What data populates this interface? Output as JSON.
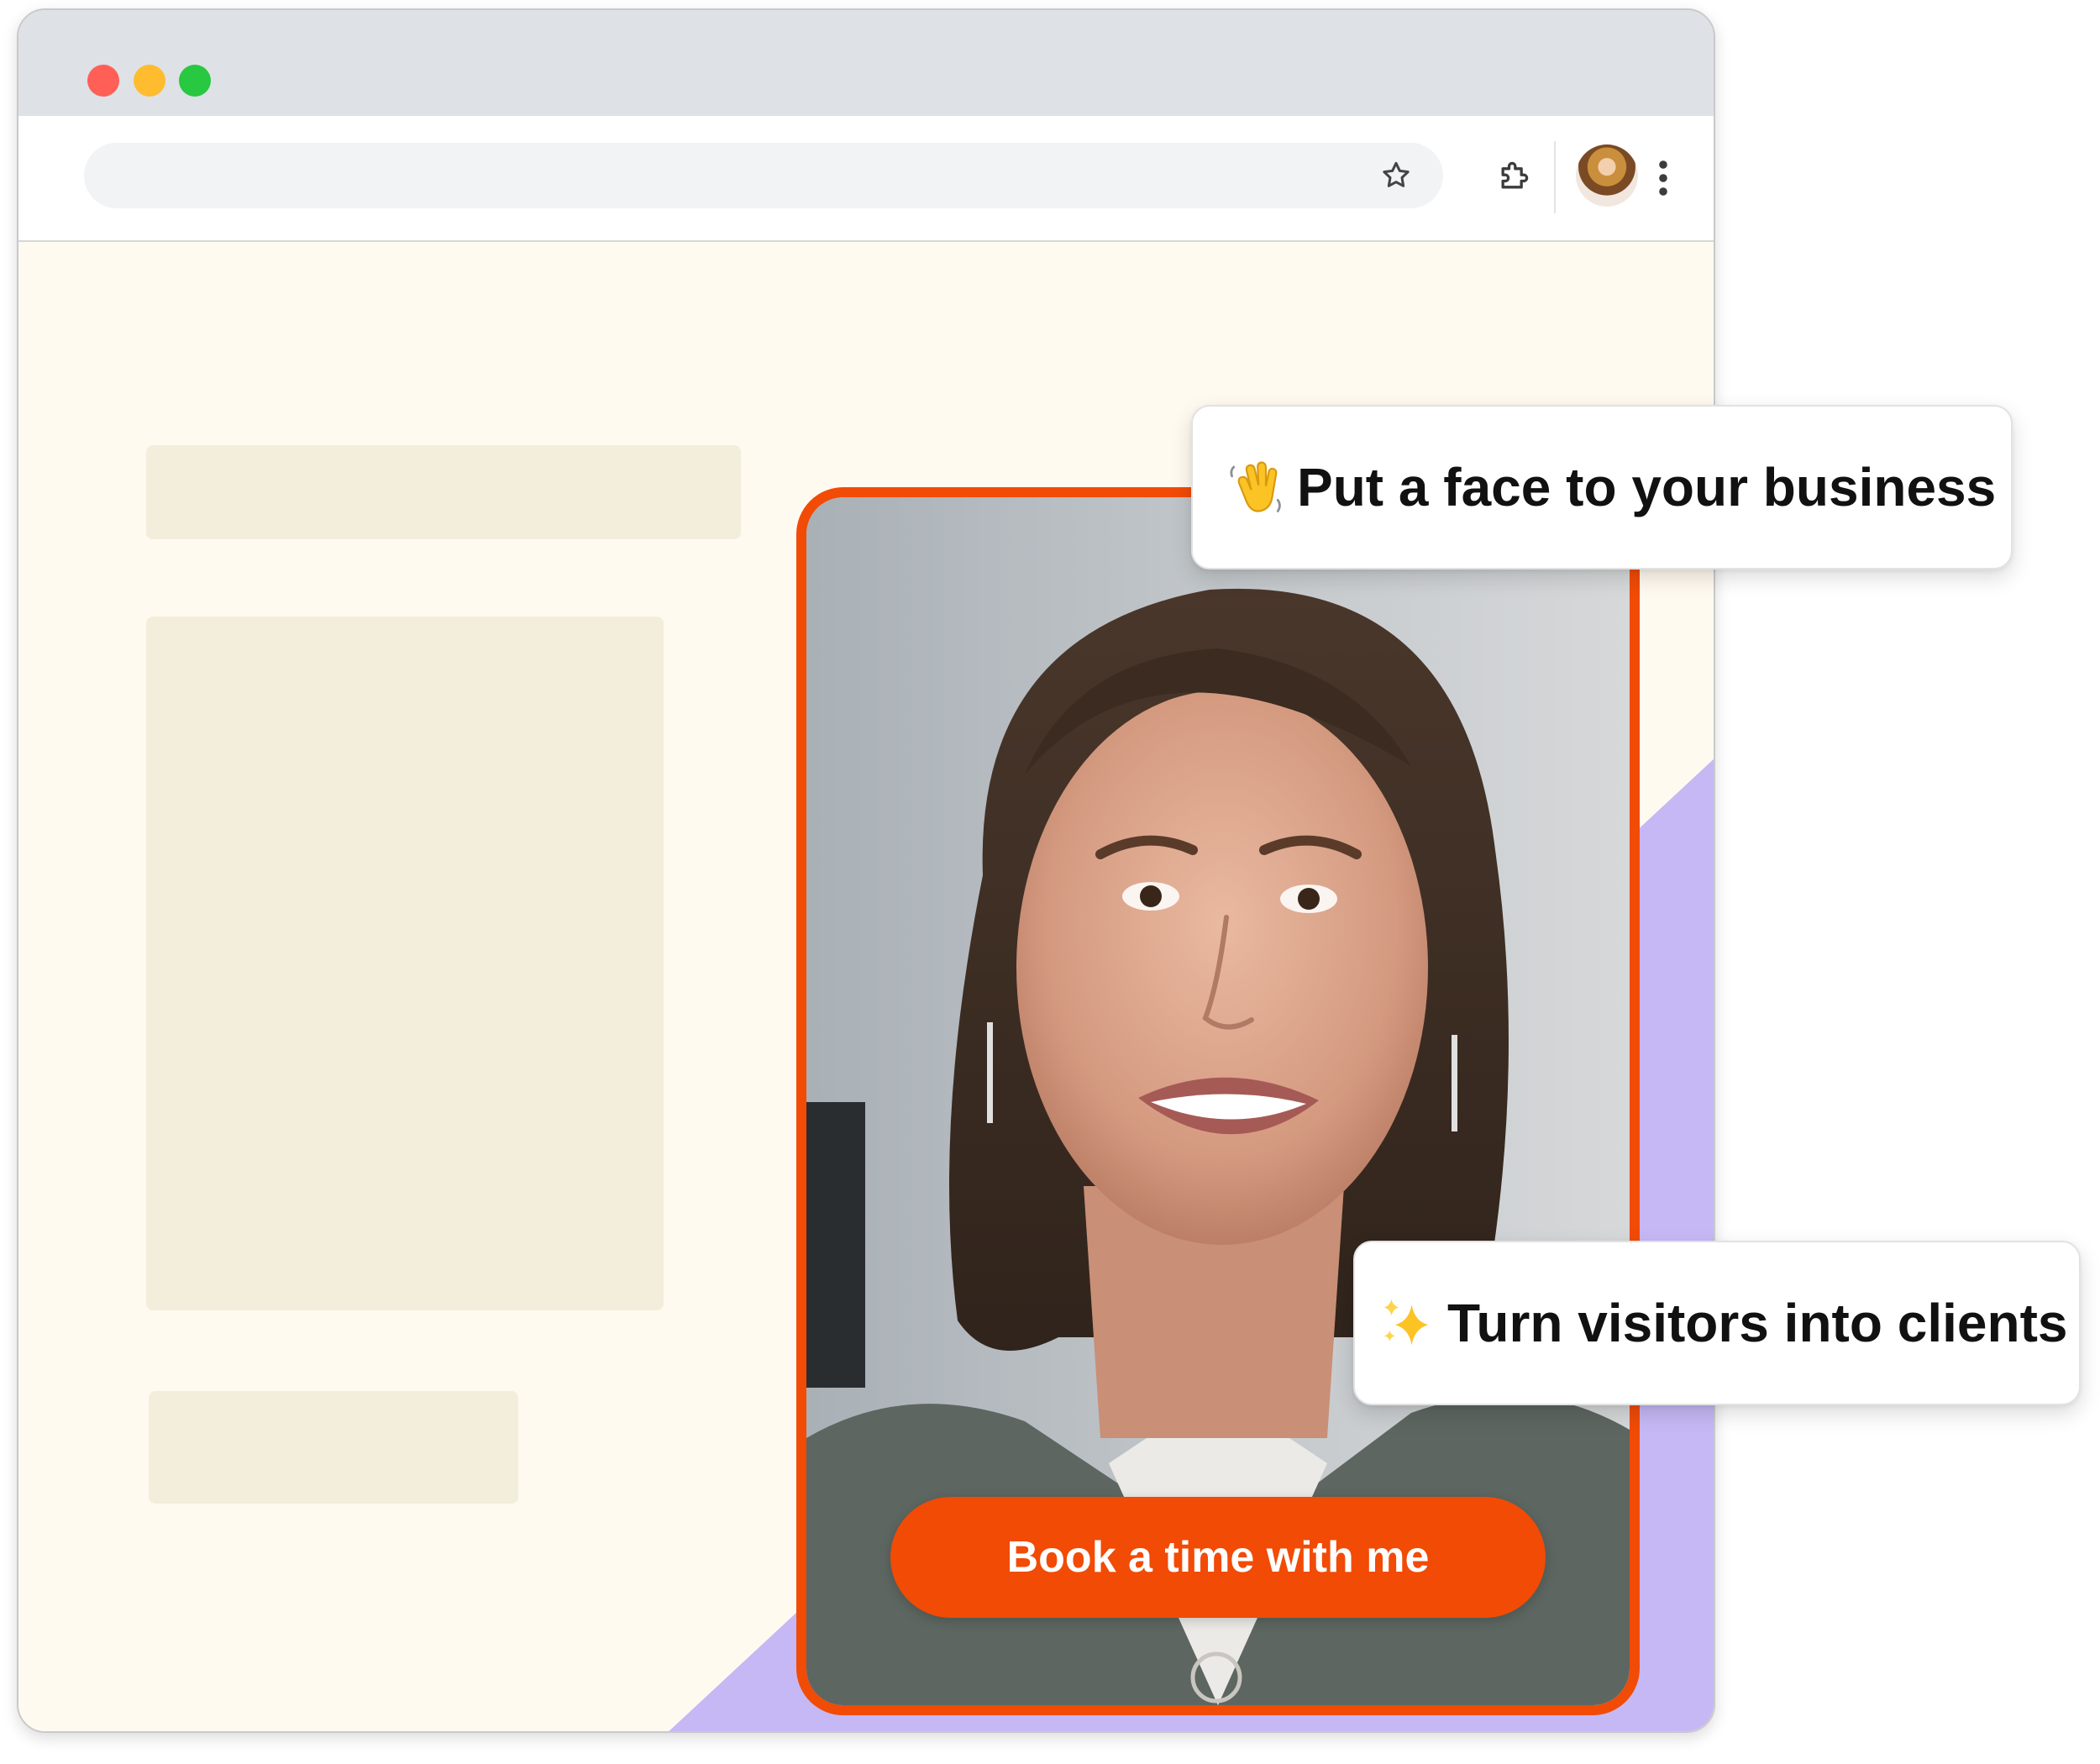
{
  "browser": {
    "window_controls": [
      "close",
      "minimize",
      "zoom"
    ],
    "toolbar": {
      "icons": [
        "star-icon",
        "extensions-icon",
        "avatar",
        "more-options-icon"
      ]
    }
  },
  "video_widget": {
    "cta_label": "Book a time with me"
  },
  "callouts": [
    {
      "emoji": "waving-hand-icon",
      "text": "Put a face to your business"
    },
    {
      "emoji": "sparkles-icon",
      "text": "Turn visitors into clients"
    }
  ],
  "colors": {
    "accent": "#f14b06",
    "page_background": "#fffaf0",
    "placeholder": "#f3eddc",
    "purple": "#c6b8f4",
    "titlebar": "#dee1e6"
  }
}
